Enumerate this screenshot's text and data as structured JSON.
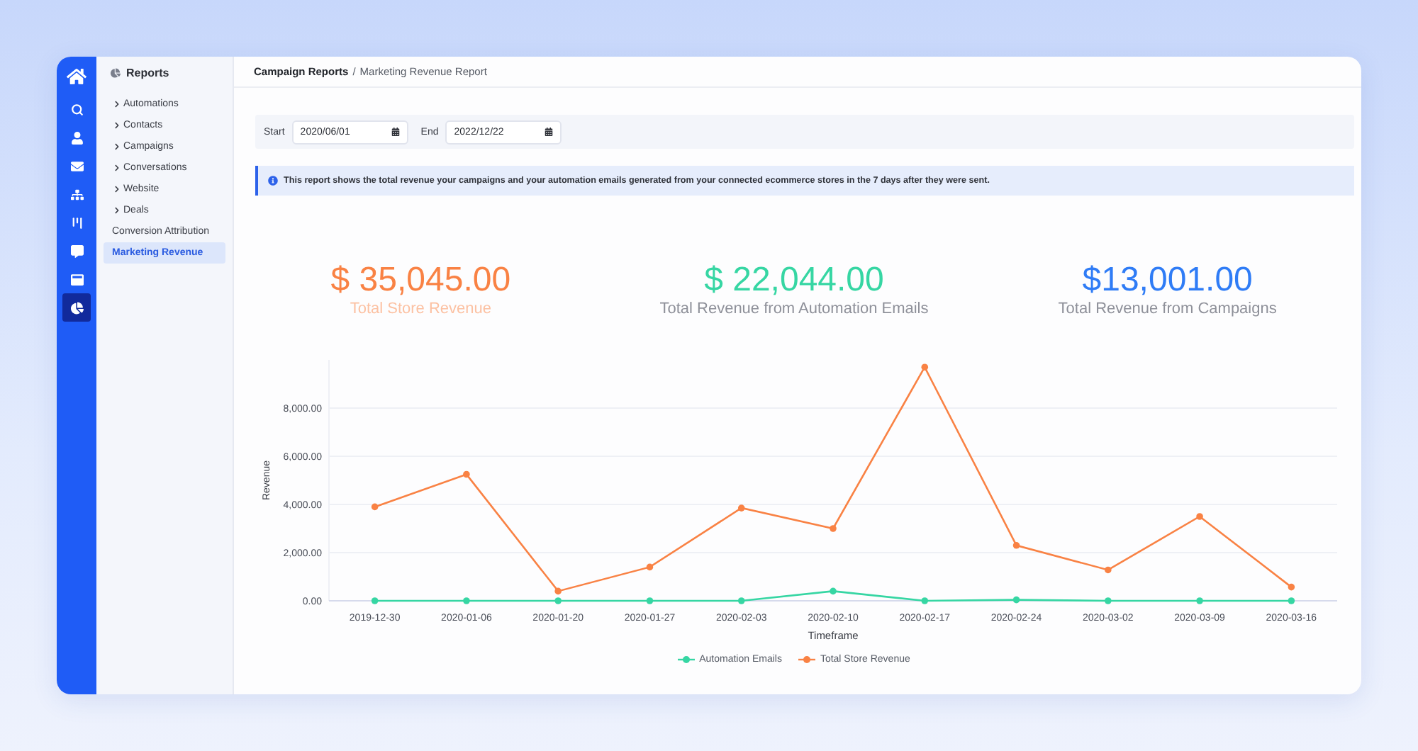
{
  "nav_rail": {
    "items": [
      {
        "selected": false
      },
      {
        "selected": false
      },
      {
        "selected": false
      },
      {
        "selected": false
      },
      {
        "selected": false
      },
      {
        "selected": false
      },
      {
        "selected": false
      },
      {
        "selected": true
      }
    ]
  },
  "sidebar": {
    "title": "Reports",
    "items": [
      {
        "label": "Automations",
        "kind": "group",
        "selected": false
      },
      {
        "label": "Contacts",
        "kind": "group",
        "selected": false
      },
      {
        "label": "Campaigns",
        "kind": "group",
        "selected": false
      },
      {
        "label": "Conversations",
        "kind": "group",
        "selected": false
      },
      {
        "label": "Website",
        "kind": "group",
        "selected": false
      },
      {
        "label": "Deals",
        "kind": "group",
        "selected": false
      },
      {
        "label": "Conversion Attribution",
        "kind": "link",
        "selected": false
      },
      {
        "label": "Marketing Revenue",
        "kind": "link",
        "selected": true
      }
    ]
  },
  "breadcrumb": {
    "parent": "Campaign Reports",
    "separator": "/",
    "current": "Marketing Revenue Report"
  },
  "date_filters": [
    {
      "label": "Start",
      "value": "2020/06/01"
    },
    {
      "label": "End",
      "value": "2022/12/22"
    }
  ],
  "notice": {
    "text": "This report shows the total revenue your campaigns and your automation emails generated from your connected ecommerce stores in the 7 days after they were sent."
  },
  "stats": [
    {
      "value": "$ 35,045.00",
      "label": "Total Store Revenue",
      "color": "#f98244",
      "highlighted": true
    },
    {
      "value": "$ 22,044.00",
      "label": "Total Revenue from Automation Emails",
      "color": "#36d6a3",
      "highlighted": false
    },
    {
      "value": "$13,001.00",
      "label": "Total Revenue from Campaigns",
      "color": "#2f7cf6",
      "highlighted": false
    }
  ],
  "chart": {
    "chart_data": {
      "type": "line",
      "xlabel": "Timeframe",
      "ylabel": "Revenue",
      "grid": true,
      "legend": true,
      "categories": [
        "2019-12-30",
        "2020-01-06",
        "2020-01-20",
        "2020-01-27",
        "2020-02-03",
        "2020-02-10",
        "2020-02-17",
        "2020-02-24",
        "2020-03-02",
        "2020-03-09",
        "2020-03-16"
      ],
      "series": [
        {
          "name": "Automation Emails",
          "color": "#36d6a3",
          "marker": "circle",
          "values": [
            0,
            0,
            0,
            0,
            0,
            400,
            0,
            40,
            0,
            0,
            0
          ]
        },
        {
          "name": "Total Store Revenue",
          "color": "#f98244",
          "marker": "circle",
          "values": [
            3900,
            5250,
            400,
            1400,
            3850,
            3000,
            9700,
            2300,
            1280,
            3500,
            570
          ]
        }
      ],
      "ylim": [
        0,
        10000
      ],
      "yticks": [
        {
          "value": 0,
          "label": "0.00"
        },
        {
          "value": 2000,
          "label": "2,000.00"
        },
        {
          "value": 4000,
          "label": "4,000.00"
        },
        {
          "value": 6000,
          "label": "6,000.00"
        },
        {
          "value": 8000,
          "label": "8,000.00"
        }
      ]
    }
  }
}
